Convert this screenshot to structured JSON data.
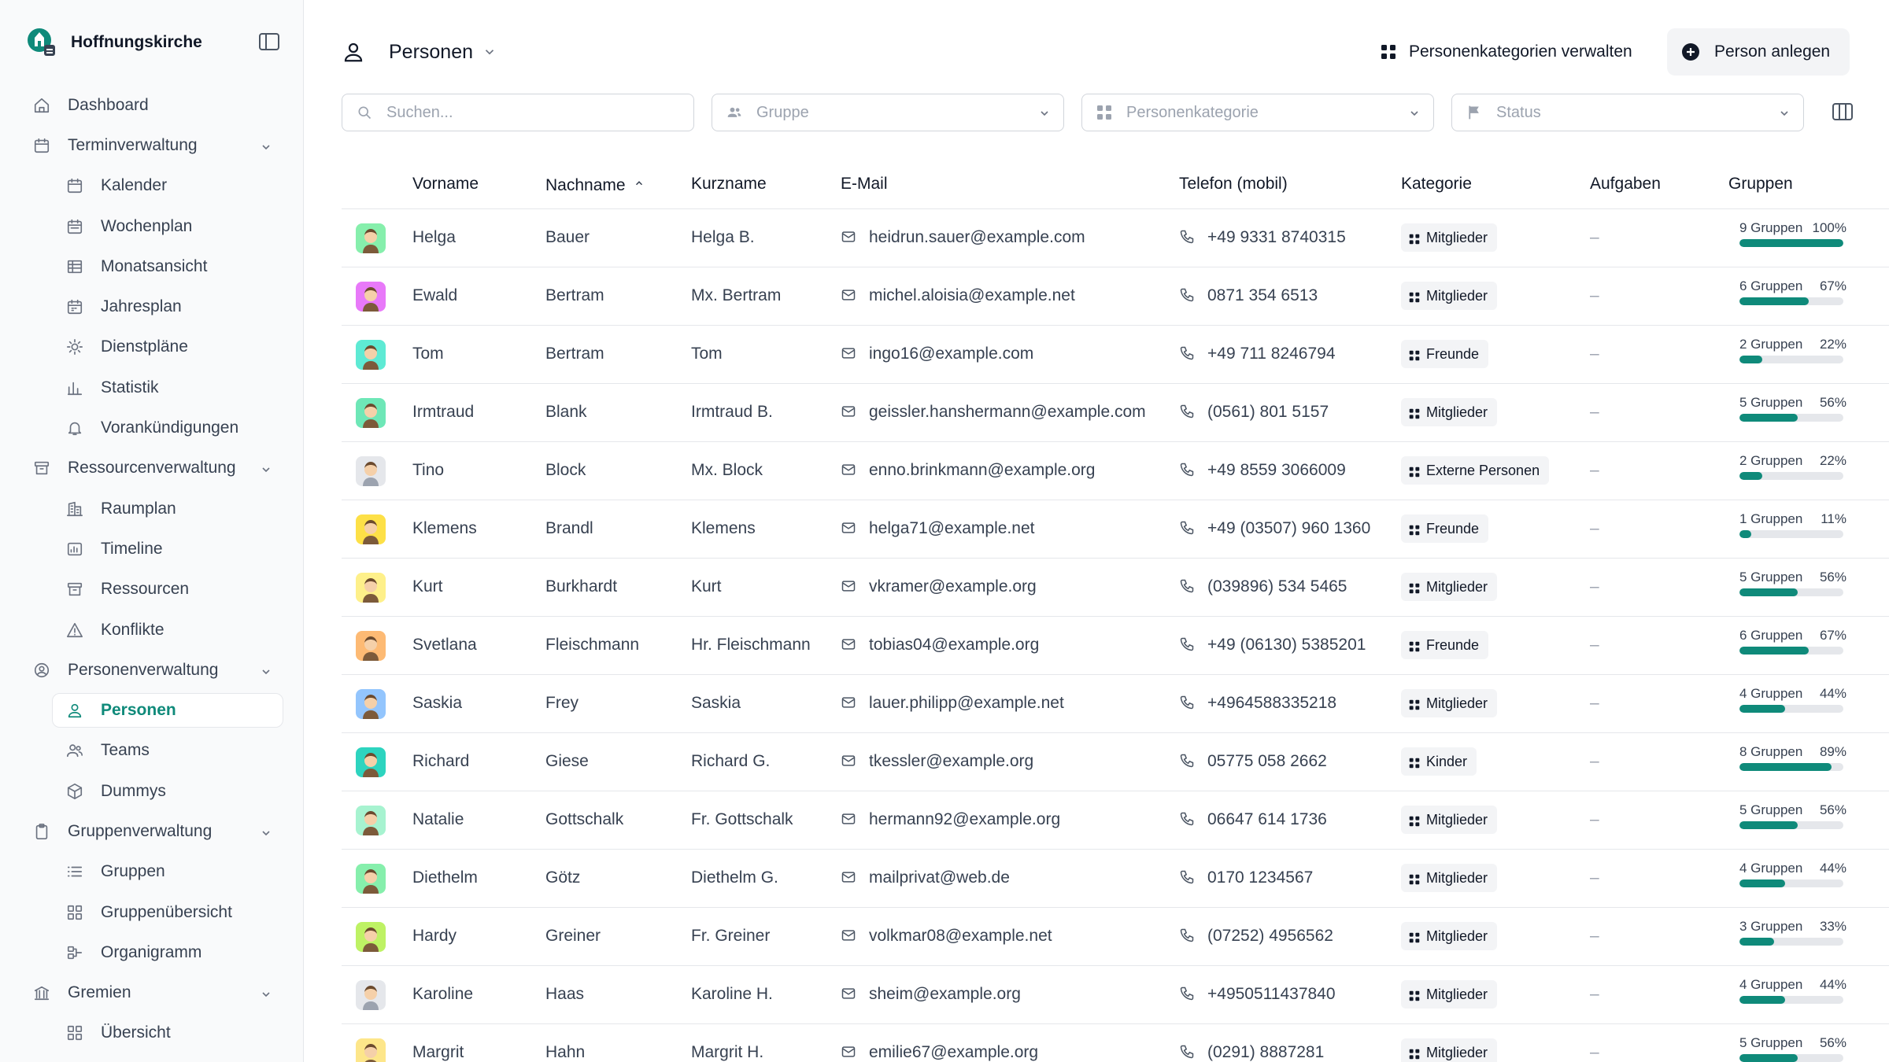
{
  "app": {
    "name": "Hoffnungskirche"
  },
  "sidebar": {
    "items": [
      {
        "label": "Dashboard",
        "icon": "home-icon",
        "level": 0
      },
      {
        "label": "Terminverwaltung",
        "icon": "calendar-icon",
        "level": 0,
        "expandable": true
      },
      {
        "label": "Kalender",
        "icon": "calendar-icon",
        "level": 1
      },
      {
        "label": "Wochenplan",
        "icon": "calendar-week-icon",
        "level": 1
      },
      {
        "label": "Monatsansicht",
        "icon": "table-icon",
        "level": 1
      },
      {
        "label": "Jahresplan",
        "icon": "calendar-year-icon",
        "level": 1
      },
      {
        "label": "Dienstpläne",
        "icon": "roster-icon",
        "level": 1
      },
      {
        "label": "Statistik",
        "icon": "bar-chart-icon",
        "level": 1
      },
      {
        "label": "Vorankündigungen",
        "icon": "bell-icon",
        "level": 1
      },
      {
        "label": "Ressourcenverwaltung",
        "icon": "archive-icon",
        "level": 0,
        "expandable": true
      },
      {
        "label": "Raumplan",
        "icon": "building-icon",
        "level": 1
      },
      {
        "label": "Timeline",
        "icon": "timeline-icon",
        "level": 1
      },
      {
        "label": "Ressourcen",
        "icon": "archive-icon",
        "level": 1
      },
      {
        "label": "Konflikte",
        "icon": "warning-icon",
        "level": 1
      },
      {
        "label": "Personenverwaltung",
        "icon": "user-circle-icon",
        "level": 0,
        "expandable": true
      },
      {
        "label": "Personen",
        "icon": "user-icon",
        "level": 1,
        "active": true
      },
      {
        "label": "Teams",
        "icon": "users-icon",
        "level": 1
      },
      {
        "label": "Dummys",
        "icon": "cube-icon",
        "level": 1
      },
      {
        "label": "Gruppenverwaltung",
        "icon": "clipboard-icon",
        "level": 0,
        "expandable": true
      },
      {
        "label": "Gruppen",
        "icon": "list-icon",
        "level": 1
      },
      {
        "label": "Gruppenübersicht",
        "icon": "grid-icon",
        "level": 1
      },
      {
        "label": "Organigramm",
        "icon": "org-chart-icon",
        "level": 1
      },
      {
        "label": "Gremien",
        "icon": "institution-icon",
        "level": 0,
        "expandable": true
      },
      {
        "label": "Übersicht",
        "icon": "grid-icon",
        "level": 1
      }
    ]
  },
  "header": {
    "title": "Personen",
    "manage_categories": "Personenkategorien verwalten",
    "add_person": "Person anlegen"
  },
  "filters": {
    "search_placeholder": "Suchen...",
    "group": "Gruppe",
    "category": "Personenkategorie",
    "status": "Status"
  },
  "table": {
    "columns": [
      "Vorname",
      "Nachname",
      "Kurzname",
      "E-Mail",
      "Telefon (mobil)",
      "Kategorie",
      "Aufgaben",
      "Gruppen"
    ],
    "rows": [
      {
        "first": "Helga",
        "last": "Bauer",
        "short": "Helga B.",
        "email": "heidrun.sauer@example.com",
        "phone": "+49 9331 8740315",
        "category": "Mitglieder",
        "tasks": "–",
        "groups": "9 Gruppen",
        "pct": "100%",
        "fill": 1.0,
        "avatar": "#86efac"
      },
      {
        "first": "Ewald",
        "last": "Bertram",
        "short": "Mx. Bertram",
        "email": "michel.aloisia@example.net",
        "phone": "0871 354 6513",
        "category": "Mitglieder",
        "tasks": "–",
        "groups": "6 Gruppen",
        "pct": "67%",
        "fill": 0.67,
        "avatar": "#e879f9"
      },
      {
        "first": "Tom",
        "last": "Bertram",
        "short": "Tom",
        "email": "ingo16@example.com",
        "phone": "+49 711 8246794",
        "category": "Freunde",
        "tasks": "–",
        "groups": "2 Gruppen",
        "pct": "22%",
        "fill": 0.22,
        "avatar": "#5eead4"
      },
      {
        "first": "Irmtraud",
        "last": "Blank",
        "short": "Irmtraud B.",
        "email": "geissler.hanshermann@example.com",
        "phone": "(0561) 801 5157",
        "category": "Mitglieder",
        "tasks": "–",
        "groups": "5 Gruppen",
        "pct": "56%",
        "fill": 0.56,
        "avatar": "#6ee7b7"
      },
      {
        "first": "Tino",
        "last": "Block",
        "short": "Mx. Block",
        "email": "enno.brinkmann@example.org",
        "phone": "+49 8559 3066009",
        "category": "Externe Personen",
        "tasks": "–",
        "groups": "2 Gruppen",
        "pct": "22%",
        "fill": 0.22,
        "avatar": "#e5e7eb"
      },
      {
        "first": "Klemens",
        "last": "Brandl",
        "short": "Klemens",
        "email": "helga71@example.net",
        "phone": "+49 (03507) 960 1360",
        "category": "Freunde",
        "tasks": "–",
        "groups": "1 Gruppen",
        "pct": "11%",
        "fill": 0.11,
        "avatar": "#fde047"
      },
      {
        "first": "Kurt",
        "last": "Burkhardt",
        "short": "Kurt",
        "email": "vkramer@example.org",
        "phone": "(039896) 534 5465",
        "category": "Mitglieder",
        "tasks": "–",
        "groups": "5 Gruppen",
        "pct": "56%",
        "fill": 0.56,
        "avatar": "#fef08a"
      },
      {
        "first": "Svetlana",
        "last": "Fleischmann",
        "short": "Hr. Fleischmann",
        "email": "tobias04@example.org",
        "phone": "+49 (06130) 5385201",
        "category": "Freunde",
        "tasks": "–",
        "groups": "6 Gruppen",
        "pct": "67%",
        "fill": 0.67,
        "avatar": "#fdba74"
      },
      {
        "first": "Saskia",
        "last": "Frey",
        "short": "Saskia",
        "email": "lauer.philipp@example.net",
        "phone": "+4964588335218",
        "category": "Mitglieder",
        "tasks": "–",
        "groups": "4 Gruppen",
        "pct": "44%",
        "fill": 0.44,
        "avatar": "#93c5fd"
      },
      {
        "first": "Richard",
        "last": "Giese",
        "short": "Richard G.",
        "email": "tkessler@example.org",
        "phone": "05775 058 2662",
        "category": "Kinder",
        "tasks": "–",
        "groups": "8 Gruppen",
        "pct": "89%",
        "fill": 0.89,
        "avatar": "#2dd4bf"
      },
      {
        "first": "Natalie",
        "last": "Gottschalk",
        "short": "Fr. Gottschalk",
        "email": "hermann92@example.org",
        "phone": "06647 614 1736",
        "category": "Mitglieder",
        "tasks": "–",
        "groups": "5 Gruppen",
        "pct": "56%",
        "fill": 0.56,
        "avatar": "#a7f3d0"
      },
      {
        "first": "Diethelm",
        "last": "Götz",
        "short": "Diethelm G.",
        "email": "mailprivat@web.de",
        "phone": "0170 1234567",
        "category": "Mitglieder",
        "tasks": "–",
        "groups": "4 Gruppen",
        "pct": "44%",
        "fill": 0.44,
        "avatar": "#86efac"
      },
      {
        "first": "Hardy",
        "last": "Greiner",
        "short": "Fr. Greiner",
        "email": "volkmar08@example.net",
        "phone": "(07252) 4956562",
        "category": "Mitglieder",
        "tasks": "–",
        "groups": "3 Gruppen",
        "pct": "33%",
        "fill": 0.33,
        "avatar": "#bef264"
      },
      {
        "first": "Karoline",
        "last": "Haas",
        "short": "Karoline H.",
        "email": "sheim@example.org",
        "phone": "+4950511437840",
        "category": "Mitglieder",
        "tasks": "–",
        "groups": "4 Gruppen",
        "pct": "44%",
        "fill": 0.44,
        "avatar": "#e5e7eb"
      },
      {
        "first": "Margrit",
        "last": "Hahn",
        "short": "Margrit H.",
        "email": "emilie67@example.org",
        "phone": "(0291) 8887281",
        "category": "Mitglieder",
        "tasks": "–",
        "groups": "5 Gruppen",
        "pct": "56%",
        "fill": 0.56,
        "avatar": "#fde68a"
      }
    ]
  },
  "colors": {
    "accent": "#0f8a7a",
    "border": "#e5e7eb",
    "muted": "#9ca3af"
  }
}
